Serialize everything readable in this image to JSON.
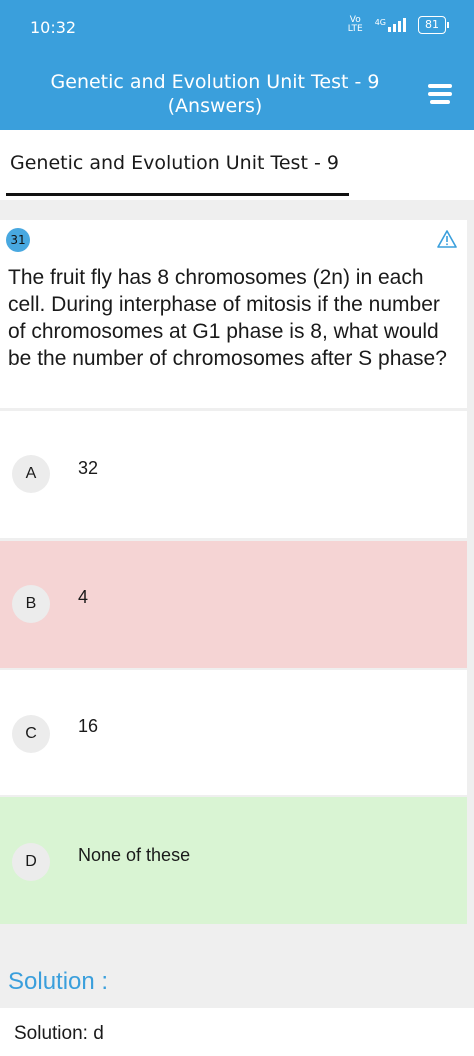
{
  "status_bar": {
    "time": "10:32",
    "volte": "Vo\nLTE",
    "network": "4G",
    "battery": "81"
  },
  "header": {
    "title": "Genetic and Evolution Unit Test - 9\n(Answers)",
    "menu_icon": "menu-icon"
  },
  "tab": {
    "title": "Genetic and Evolution Unit Test - 9"
  },
  "question": {
    "number": "31",
    "text": "The fruit fly has 8 chromosomes (2n) in each cell. During interphase of mitosis if the number of chromosomes at G1 phase is 8, what would be the number of chromosomes after S phase?",
    "report_icon": "warning-icon"
  },
  "options": [
    {
      "letter": "A",
      "text": "32",
      "state": "neutral"
    },
    {
      "letter": "B",
      "text": "4",
      "state": "wrong"
    },
    {
      "letter": "C",
      "text": "16",
      "state": "neutral"
    },
    {
      "letter": "D",
      "text": "None of these",
      "state": "correct"
    }
  ],
  "solution": {
    "heading": "Solution :",
    "text": "Solution: d"
  },
  "colors": {
    "header": "#3a9fdc",
    "wrong": "#f5d4d4",
    "correct": "#d9f4d3"
  }
}
